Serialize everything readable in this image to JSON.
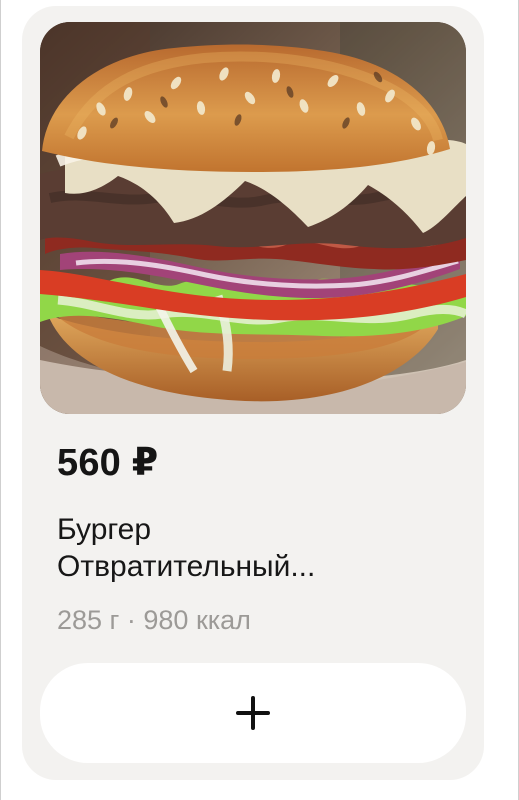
{
  "product": {
    "price": "560 ₽",
    "title_line_1": "Бургер",
    "title_line_2": "Отвратительный...",
    "meta": "285 г · 980 ккал"
  },
  "image": {
    "subject": "burger-photo",
    "colors": {
      "bun": "#d89b4d",
      "sesame": "#f2e6c9",
      "sauce": "#f1ead6",
      "patty": "#5e4036",
      "bacon": "#9c2c22",
      "onion": "#9d3f6a",
      "tomato": "#d83b25",
      "lettuce": "#8ccf3e",
      "background": "#6a5548"
    }
  },
  "actions": {
    "add_icon": "plus-icon"
  }
}
